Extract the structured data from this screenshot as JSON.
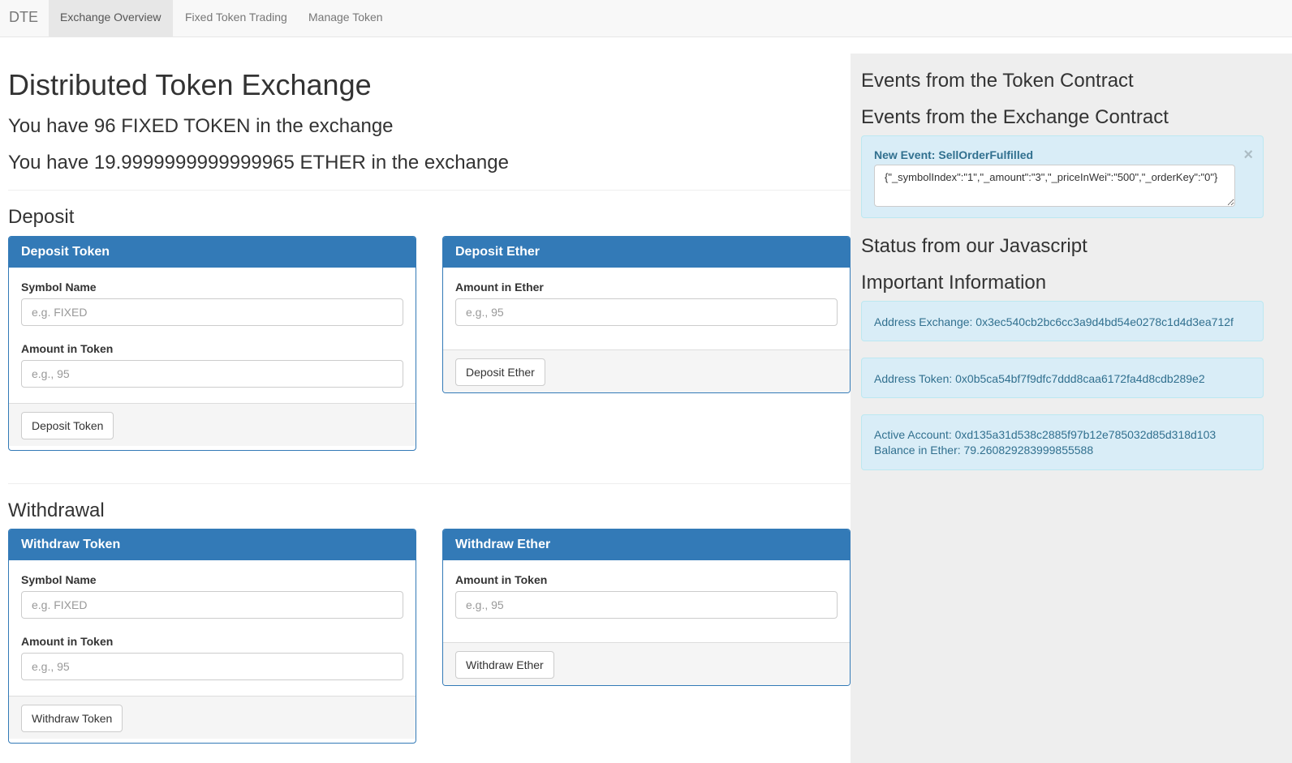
{
  "navbar": {
    "brand": "DTE",
    "items": [
      {
        "label": "Exchange Overview",
        "active": true
      },
      {
        "label": "Fixed Token Trading",
        "active": false
      },
      {
        "label": "Manage Token",
        "active": false
      }
    ]
  },
  "main": {
    "title": "Distributed Token Exchange",
    "balance_token": "You have 96 FIXED TOKEN in the exchange",
    "balance_ether": "You have 19.9999999999999965 ETHER in the exchange",
    "deposit": {
      "section_title": "Deposit",
      "token_panel": {
        "heading": "Deposit Token",
        "symbol_label": "Symbol Name",
        "symbol_placeholder": "e.g. FIXED",
        "amount_label": "Amount in Token",
        "amount_placeholder": "e.g., 95",
        "button": "Deposit Token"
      },
      "ether_panel": {
        "heading": "Deposit Ether",
        "amount_label": "Amount in Ether",
        "amount_placeholder": "e.g., 95",
        "button": "Deposit Ether"
      }
    },
    "withdrawal": {
      "section_title": "Withdrawal",
      "token_panel": {
        "heading": "Withdraw Token",
        "symbol_label": "Symbol Name",
        "symbol_placeholder": "e.g. FIXED",
        "amount_label": "Amount in Token",
        "amount_placeholder": "e.g., 95",
        "button": "Withdraw Token"
      },
      "ether_panel": {
        "heading": "Withdraw Ether",
        "amount_label": "Amount in Token",
        "amount_placeholder": "e.g., 95",
        "button": "Withdraw Ether"
      }
    }
  },
  "sidebar": {
    "token_events_title": "Events from the Token Contract",
    "exchange_events_title": "Events from the Exchange Contract",
    "event": {
      "title": "New Event: SellOrderFulfilled",
      "close": "×",
      "payload": "{\"_symbolIndex\":\"1\",\"_amount\":\"3\",\"_priceInWei\":\"500\",\"_orderKey\":\"0\"}"
    },
    "status_title": "Status from our Javascript",
    "info_title": "Important Information",
    "address_exchange": "Address Exchange: 0x3ec540cb2bc6cc3a9d4bd54e0278c1d4d3ea712f",
    "address_token": "Address Token: 0x0b5ca54bf7f9dfc7ddd8caa6172fa4d8cdb289e2",
    "active_account": "Active Account: 0xd135a31d538c2885f97b12e785032d85d318d103",
    "balance_ether": "Balance in Ether: 79.260829283999855588"
  },
  "colors": {
    "primary": "#337ab7",
    "info_bg": "#d9edf7",
    "info_text": "#31708f",
    "sidebar_bg": "#eeeeee",
    "navbar_bg": "#f8f8f8"
  }
}
